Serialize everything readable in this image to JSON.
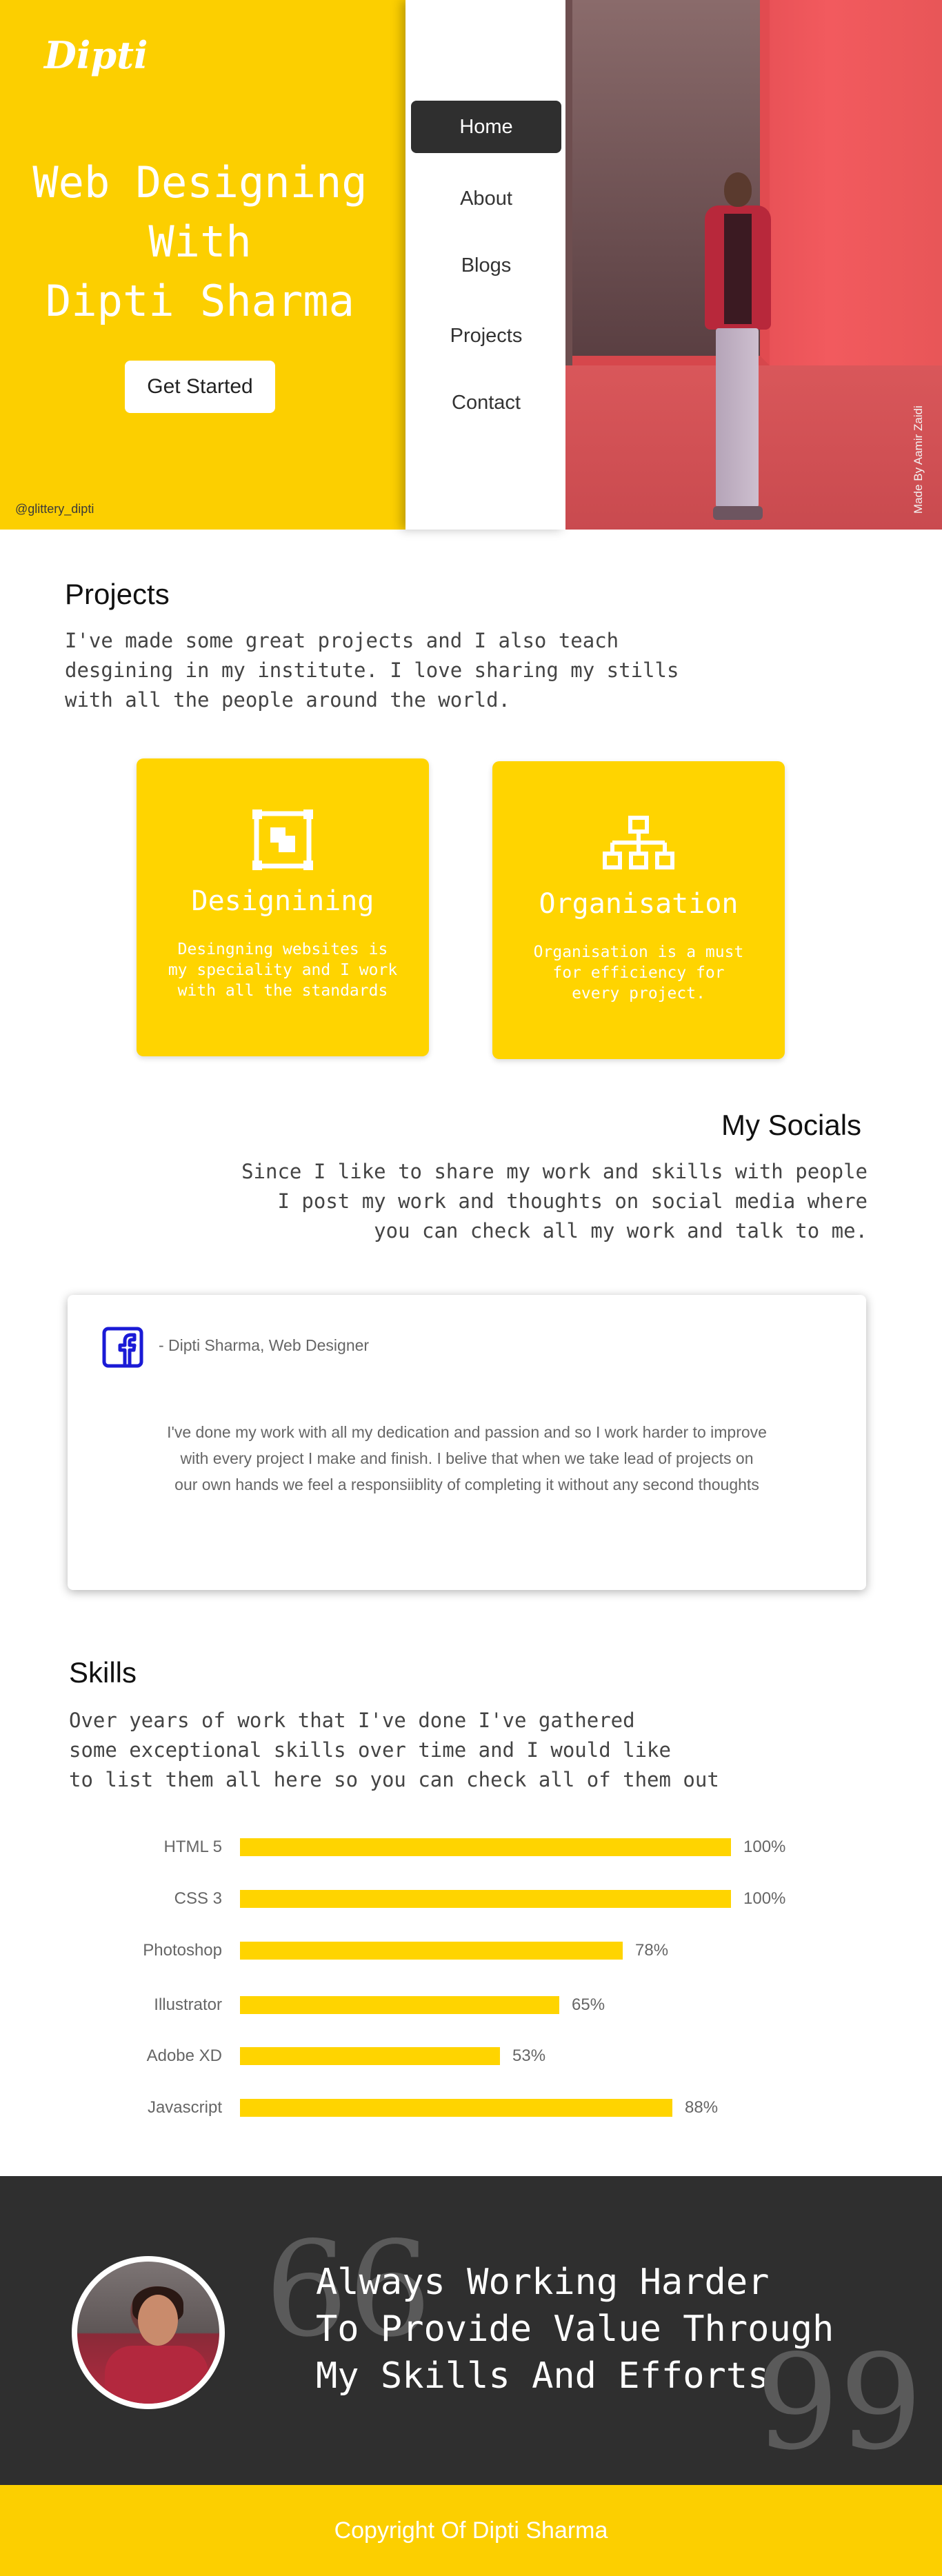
{
  "hero": {
    "logo": "Dipti",
    "title_lines": [
      "Web Designing",
      "With",
      "Dipti Sharma"
    ],
    "cta_label": "Get Started",
    "handle": "@glittery_dipti",
    "photo_credit": "Made By Aamir Zaidi"
  },
  "nav": {
    "items": [
      {
        "label": "Home",
        "active": true
      },
      {
        "label": "About",
        "active": false
      },
      {
        "label": "Blogs",
        "active": false
      },
      {
        "label": "Projects",
        "active": false
      },
      {
        "label": "Contact",
        "active": false
      }
    ]
  },
  "projects": {
    "heading": "Projects",
    "text_lines": [
      "I've made some great projects and I also teach",
      "desgining in my institute. I love sharing my stills",
      "with all the people around the world."
    ],
    "cards": [
      {
        "icon": "design-frame-icon",
        "title": "Designining",
        "desc_lines": [
          "Desingning websites is",
          "my speciality and I work",
          "with all the standards"
        ]
      },
      {
        "icon": "org-chart-icon",
        "title": "Organisation",
        "desc_lines": [
          "Organisation is a must",
          "for efficiency for",
          "every project."
        ]
      }
    ]
  },
  "socials": {
    "heading": "My Socials",
    "text_lines": [
      "Since I like to share my work and skills with people",
      "I post my work and thoughts on social media where",
      "you can check all my work and talk to me."
    ],
    "testimonial": {
      "icon": "facebook-icon",
      "author": "- Dipti Sharma, Web Designer",
      "body_lines": [
        "I've done my work with all my dedication and passion and so I work harder to improve",
        "with every project I make and finish. I belive that when we take lead of projects on",
        "our own hands we feel a responsiiblity of completing it without any second thoughts"
      ]
    }
  },
  "skills": {
    "heading": "Skills",
    "text_lines": [
      "Over years of work that I've done I've gathered",
      "some exceptional skills over time and I would like",
      "to list them all here so you can check all of them out"
    ],
    "items": [
      {
        "name": "HTML 5",
        "percent": 100,
        "label": "100%"
      },
      {
        "name": "CSS 3",
        "percent": 100,
        "label": "100%"
      },
      {
        "name": "Photoshop",
        "percent": 78,
        "label": "78%"
      },
      {
        "name": "Illustrator",
        "percent": 65,
        "label": "65%"
      },
      {
        "name": "Adobe XD",
        "percent": 53,
        "label": "53%"
      },
      {
        "name": "Javascript",
        "percent": 88,
        "label": "88%"
      }
    ]
  },
  "quote": {
    "open_mark": "66",
    "close_mark": "99",
    "lines": [
      "Always Working Harder",
      "To Provide Value Through",
      "My Skills And Efforts"
    ]
  },
  "footer": {
    "copyright": "Copyright Of Dipti Sharma"
  },
  "colors": {
    "accent": "#FCCF00",
    "dark": "#2f2f2f",
    "facebook": "#1a1ad6"
  }
}
